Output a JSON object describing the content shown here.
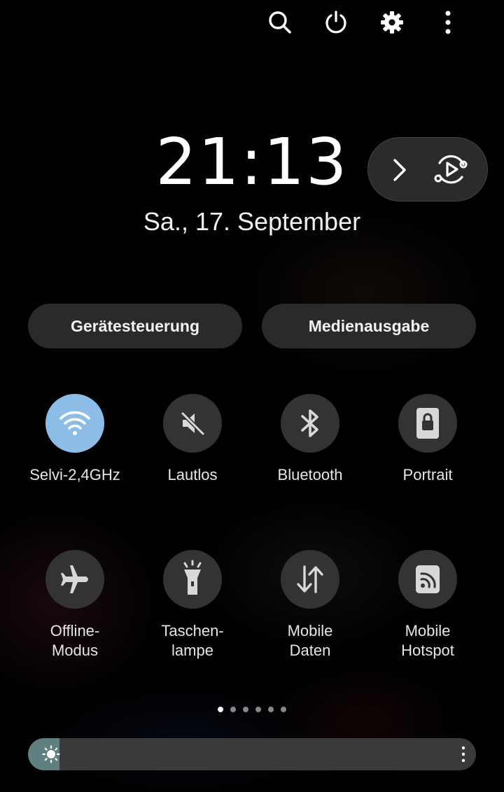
{
  "header": {
    "icons": [
      "search-icon",
      "power-icon",
      "settings-icon",
      "more-vert-icon"
    ]
  },
  "clock": {
    "time": "21:13",
    "date": "Sa., 17. September"
  },
  "media_control": {
    "icons": [
      "chevron-right-icon",
      "media-play-icon"
    ]
  },
  "buttons": {
    "device_control": "Gerätesteuerung",
    "media_output": "Medienausgabe"
  },
  "tiles": [
    {
      "label": "Selvi-2,4GHz",
      "icon": "wifi-icon",
      "active": true
    },
    {
      "label": "Lautlos",
      "icon": "mute-icon",
      "active": false
    },
    {
      "label": "Bluetooth",
      "icon": "bluetooth-icon",
      "active": false
    },
    {
      "label": "Portrait",
      "icon": "rotation-lock-icon",
      "active": false
    },
    {
      "label": "Offline-\nModus",
      "icon": "airplane-icon",
      "active": false
    },
    {
      "label": "Taschen-\nlampe",
      "icon": "flashlight-icon",
      "active": false
    },
    {
      "label": "Mobile\nDaten",
      "icon": "mobile-data-icon",
      "active": false
    },
    {
      "label": "Mobile\nHotspot",
      "icon": "hotspot-icon",
      "active": false
    }
  ],
  "pager": {
    "count": 6,
    "active_index": 0
  },
  "brightness": {
    "level": 0.07
  },
  "colors": {
    "active_tile": "#8cbde6",
    "inactive_tile": "#333333",
    "brightness_fill": "#5f7f80"
  }
}
